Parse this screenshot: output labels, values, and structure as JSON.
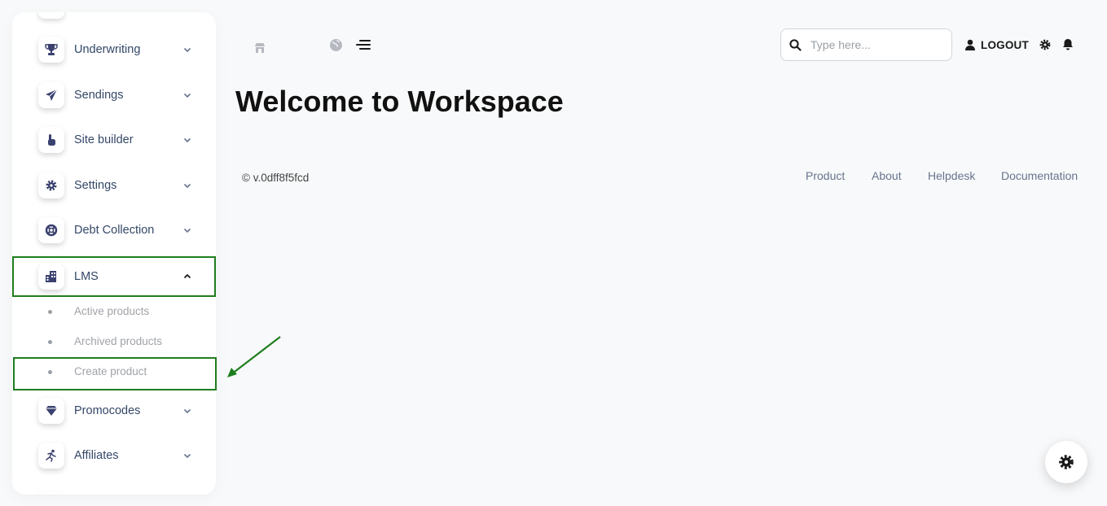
{
  "sidebar": {
    "items": [
      {
        "label": "Underwriting",
        "icon": "trophy-icon"
      },
      {
        "label": "Sendings",
        "icon": "paper-plane-icon"
      },
      {
        "label": "Site builder",
        "icon": "hand-pointer-icon"
      },
      {
        "label": "Settings",
        "icon": "gear-icon"
      },
      {
        "label": "Debt Collection",
        "icon": "life-ring-icon"
      },
      {
        "label": "LMS",
        "icon": "building-icon"
      },
      {
        "label": "Promocodes",
        "icon": "gem-icon"
      },
      {
        "label": "Affiliates",
        "icon": "running-person-icon"
      }
    ],
    "lms_subitems": [
      {
        "label": "Active products"
      },
      {
        "label": "Archived products"
      },
      {
        "label": "Create product"
      }
    ]
  },
  "topbar": {
    "search_placeholder": "Type here...",
    "logout_label": "LOGOUT"
  },
  "main": {
    "title": "Welcome to Workspace"
  },
  "footer": {
    "copyright": "© v.0dff8f5fcd",
    "links": [
      {
        "label": "Product"
      },
      {
        "label": "About"
      },
      {
        "label": "Helpdesk"
      },
      {
        "label": "Documentation"
      }
    ]
  },
  "colors": {
    "annotation": "#1e7e1e",
    "text": "#344767",
    "muted": "#a0a3a8",
    "background": "#f8f9fa"
  }
}
